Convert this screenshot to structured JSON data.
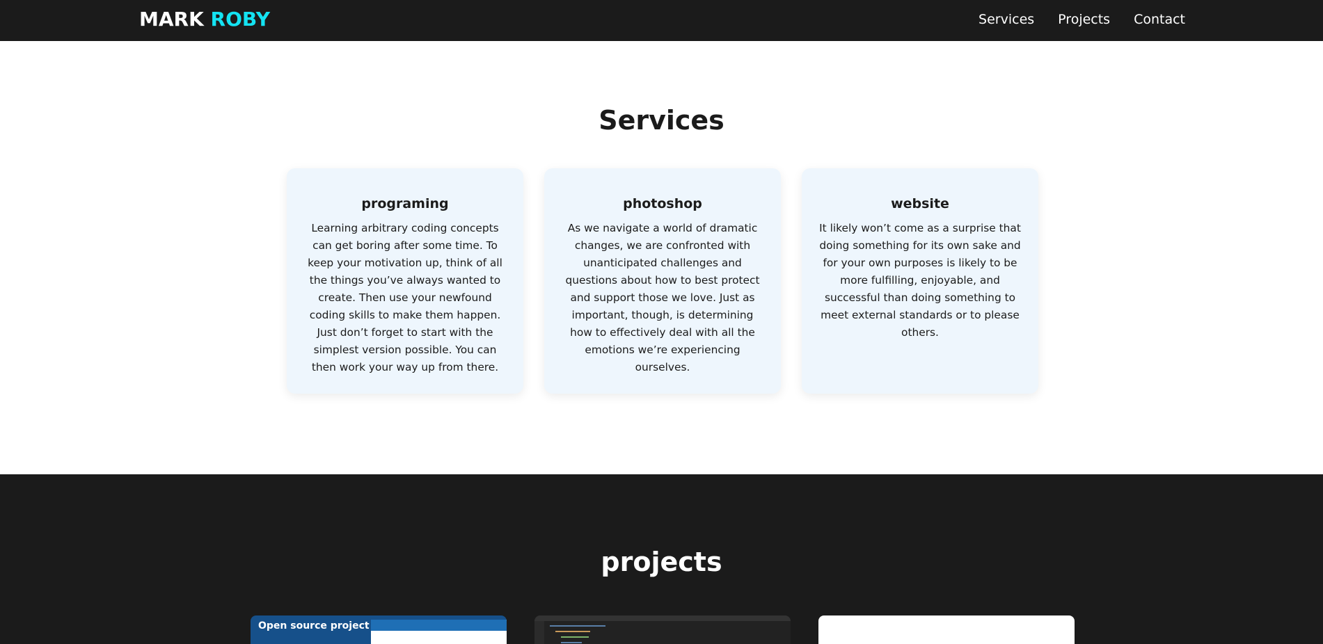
{
  "nav": {
    "logo_primary": "MARK",
    "logo_accent": "ROBY",
    "links": [
      "Services",
      "Projects",
      "Contact"
    ]
  },
  "services": {
    "title": "Services",
    "cards": [
      {
        "title": "programing",
        "text": "Learning arbitrary coding concepts can get boring after some time. To keep your motivation up, think of all the things you’ve always wanted to create. Then use your newfound coding skills to make them happen. Just don’t forget to start with the simplest version possible. You can then work your way up from there."
      },
      {
        "title": "photoshop",
        "text": "As we navigate a world of dramatic changes, we are confronted with unanticipated challenges and questions about how to best protect and support those we love. Just as important, though, is determining how to effectively deal with all the emotions we’re experiencing ourselves."
      },
      {
        "title": "website",
        "text": "It likely won’t come as a surprise that doing something for its own sake and for your own purposes is likely to be more fulfilling, enjoyable, and successful than doing something to meet external standards or to please others."
      }
    ]
  },
  "projects": {
    "title": "projects",
    "thumbs": [
      {
        "caption": "Open source project"
      },
      {
        "caption": ""
      },
      {
        "caption": ""
      }
    ]
  },
  "colors": {
    "nav_bg": "#1b1b1b",
    "accent": "#14e3f2",
    "card_bg": "#eef6fd",
    "text": "#1b1b1b"
  }
}
